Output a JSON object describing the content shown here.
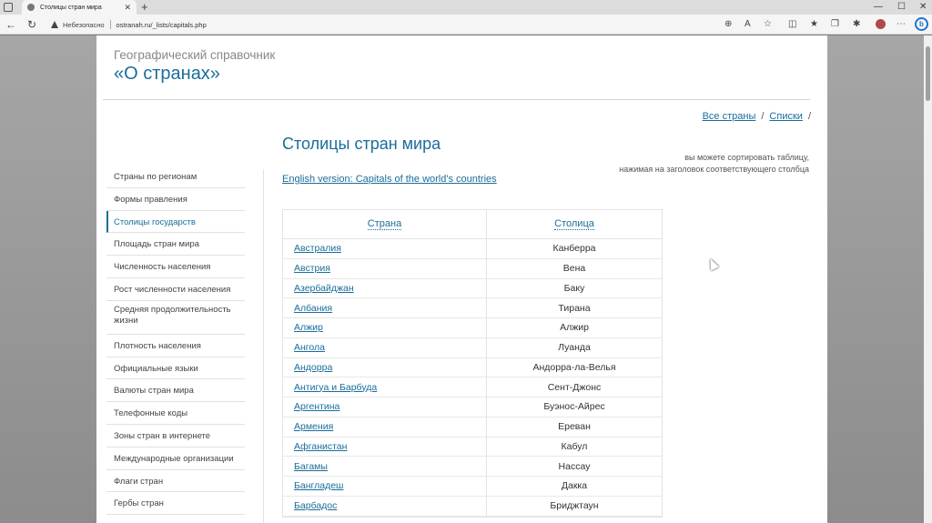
{
  "browser": {
    "tab_title": "Столицы стран мира",
    "tab_close": "✕",
    "new_tab": "+",
    "insecure_label": "Небезопасно",
    "url": "ostranah.ru/_lists/capitals.php",
    "icons": [
      "zoom-icon",
      "read-aloud-icon",
      "favorite-star-icon",
      "split-screen-icon",
      "favorites-icon",
      "collections-icon",
      "extensions-icon",
      "profile-icon",
      "more-icon",
      "bing-icon"
    ]
  },
  "site": {
    "subtitle": "Географический справочник",
    "title": "«О странах»"
  },
  "breadcrumb": {
    "item1": "Все страны",
    "sep": "/",
    "item2": "Списки",
    "trailing": "/"
  },
  "page": {
    "heading": "Столицы стран мира",
    "sort_hint_line1": "вы можете сортировать таблицу,",
    "sort_hint_line2": "нажимая на заголовок соответствующего столбца",
    "english_link": "English version: Capitals of the world's countries"
  },
  "sidebar": {
    "items": [
      {
        "label": "Страны по регионам"
      },
      {
        "label": "Формы правления"
      },
      {
        "label": "Столицы государств"
      },
      {
        "label": "Площадь стран мира"
      },
      {
        "label": "Численность населения"
      },
      {
        "label": "Рост численности населения"
      },
      {
        "label": "Средняя продолжительность жизни"
      },
      {
        "label": "Плотность населения"
      },
      {
        "label": "Официальные языки"
      },
      {
        "label": "Валюты стран мира"
      },
      {
        "label": "Телефонные коды"
      },
      {
        "label": "Зоны стран в интернете"
      },
      {
        "label": "Международные организации"
      },
      {
        "label": "Флаги стран"
      },
      {
        "label": "Гербы стран"
      }
    ]
  },
  "table": {
    "headers": {
      "country": "Страна",
      "capital": "Столица"
    },
    "rows": [
      {
        "country": "Австралия",
        "capital": "Канберра"
      },
      {
        "country": "Австрия",
        "capital": "Вена"
      },
      {
        "country": "Азербайджан",
        "capital": "Баку"
      },
      {
        "country": "Албания",
        "capital": "Тирана"
      },
      {
        "country": "Алжир",
        "capital": "Алжир"
      },
      {
        "country": "Ангола",
        "capital": "Луанда"
      },
      {
        "country": "Андорра",
        "capital": "Андорра-ла-Велья"
      },
      {
        "country": "Антигуа и Барбуда",
        "capital": "Сент-Джонс"
      },
      {
        "country": "Аргентина",
        "capital": "Буэнос-Айрес"
      },
      {
        "country": "Армения",
        "capital": "Ереван"
      },
      {
        "country": "Афганистан",
        "capital": "Кабул"
      },
      {
        "country": "Багамы",
        "capital": "Нассау"
      },
      {
        "country": "Бангладеш",
        "capital": "Дакка"
      },
      {
        "country": "Барбадос",
        "capital": "Бриджтаун"
      }
    ]
  },
  "colors": {
    "accent": "#1a6d9a",
    "text": "#333333",
    "muted": "#888888",
    "border": "#e3e3e3"
  }
}
